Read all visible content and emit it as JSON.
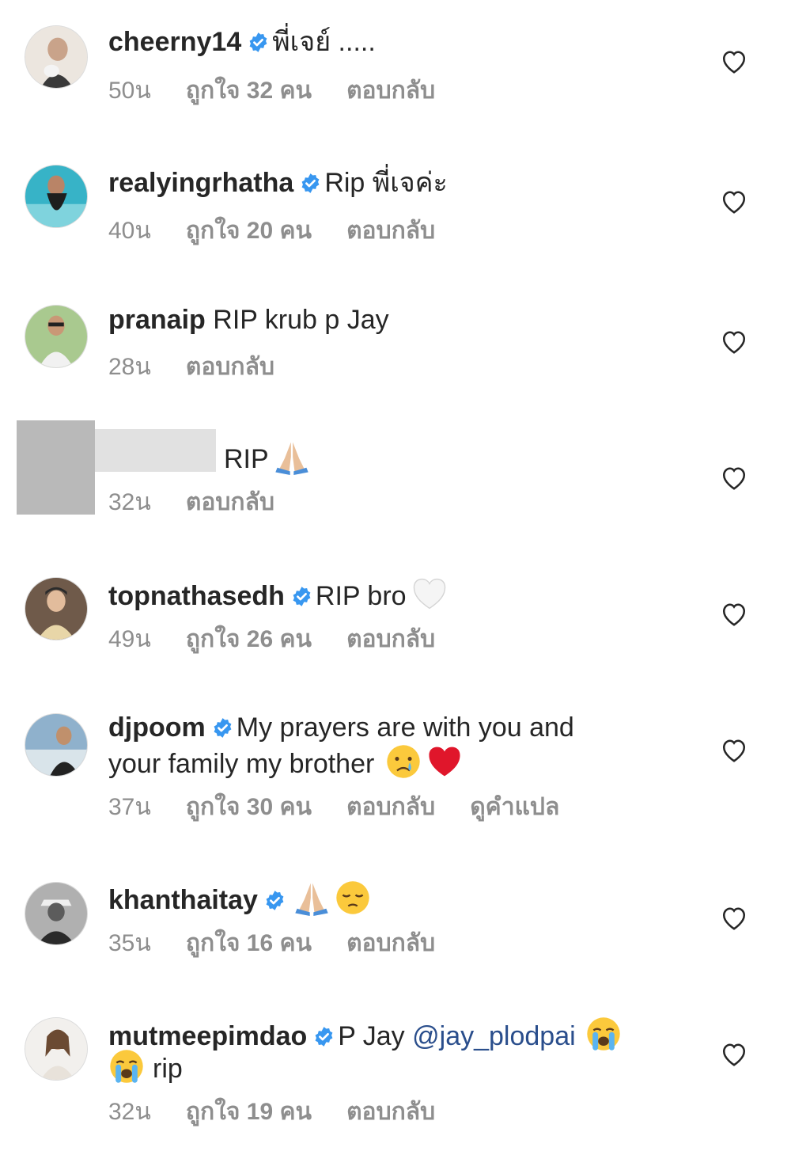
{
  "comments": [
    {
      "username": "cheerny14",
      "verified": true,
      "text": "พี่เจย์ .....",
      "time": "50น",
      "likes": "ถูกใจ 32 คน",
      "reply": "ตอบกลับ"
    },
    {
      "username": "realyingrhatha",
      "verified": true,
      "text": "Rip พี่เจค่ะ",
      "time": "40น",
      "likes": "ถูกใจ 20 คน",
      "reply": "ตอบกลับ"
    },
    {
      "username": "pranaip",
      "verified": false,
      "text": "RIP krub p Jay",
      "time": "28น",
      "reply": "ตอบกลับ"
    },
    {
      "username": "",
      "verified": false,
      "text": "RIP",
      "emoji": "folded-hands-emoji",
      "time": "32น",
      "reply": "ตอบกลับ"
    },
    {
      "username": "topnathasedh",
      "verified": true,
      "text": "RIP bro",
      "emoji": "white-heart-emoji",
      "time": "49น",
      "likes": "ถูกใจ 26 คน",
      "reply": "ตอบกลับ"
    },
    {
      "username": "djpoom",
      "verified": true,
      "text_line1": "My prayers are with you and",
      "text_line2": "your family my brother",
      "emojis": [
        "crying-face-emoji",
        "red-heart-emoji"
      ],
      "time": "37น",
      "likes": "ถูกใจ 30 คน",
      "reply": "ตอบกลับ",
      "translate": "ดูคำแปล"
    },
    {
      "username": "khanthaitay",
      "verified": true,
      "emojis": [
        "folded-hands-emoji",
        "pensive-face-emoji"
      ],
      "time": "35น",
      "likes": "ถูกใจ 16 คน",
      "reply": "ตอบกลับ"
    },
    {
      "username": "mutmeepimdao",
      "verified": true,
      "text": "P Jay",
      "mention": "@jay_plodpai",
      "text_line2": "rip",
      "emojis": [
        "loudly-crying-face-emoji",
        "loudly-crying-face-emoji"
      ],
      "time": "32น",
      "likes": "ถูกใจ 19 คน",
      "reply": "ตอบกลับ"
    }
  ],
  "colors": {
    "text": "#262626",
    "meta": "#8e8e8e",
    "verified_badge": "#3897f0",
    "mention": "#2a4e8c"
  },
  "icons": {
    "like": "heart-outline-icon",
    "verified": "verified-badge-icon"
  }
}
